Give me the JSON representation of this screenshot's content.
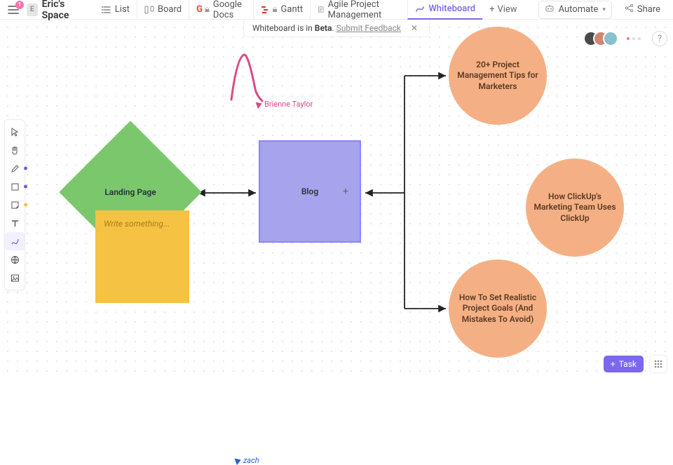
{
  "header": {
    "notifications": "1",
    "space_initial": "E",
    "space_name": "Eric's Space",
    "views": [
      {
        "label": "List",
        "icon": "list-icon"
      },
      {
        "label": "Board",
        "icon": "board-icon"
      },
      {
        "label": "Google Docs",
        "icon": "gdocs-icon"
      },
      {
        "label": "Gantt",
        "icon": "gantt-icon"
      },
      {
        "label": "Agile Project Management",
        "icon": "doc-icon"
      },
      {
        "label": "Whiteboard",
        "icon": "whiteboard-icon"
      }
    ],
    "add_view_label": "View",
    "automate_label": "Automate",
    "share_label": "Share"
  },
  "beta": {
    "text_prefix": "Whiteboard is in ",
    "text_bold": "Beta",
    "text_suffix": ". ",
    "feedback_link": "Submit Feedback"
  },
  "tools": [
    {
      "name": "select-tool",
      "color": null
    },
    {
      "name": "hand-tool",
      "color": null
    },
    {
      "name": "pen-tool",
      "color": "#6c5ce7"
    },
    {
      "name": "shape-tool",
      "color": "#6c5ce7"
    },
    {
      "name": "sticky-tool",
      "color": "#f5c244"
    },
    {
      "name": "text-tool",
      "color": null
    },
    {
      "name": "connector-tool",
      "color": null,
      "active": true
    },
    {
      "name": "embed-tool",
      "color": null
    },
    {
      "name": "image-tool",
      "color": null
    }
  ],
  "canvas": {
    "diamond_label": "Landing Page",
    "square_label": "Blog",
    "circles": [
      "20+ Project Management Tips for Marketers",
      "How ClickUp's Marketing Team Uses ClickUp",
      "How To Set Realistic Project Goals (And Mistakes To Avoid)"
    ],
    "sticky_placeholder": "Write something...",
    "cursors": {
      "brienne": "Brienne Taylor",
      "zach": "zach"
    }
  },
  "collaborators": {
    "avatars": [
      "#4a4a4a",
      "#d08770",
      "#88c0d0"
    ]
  },
  "bottom": {
    "task_label": "Task"
  }
}
